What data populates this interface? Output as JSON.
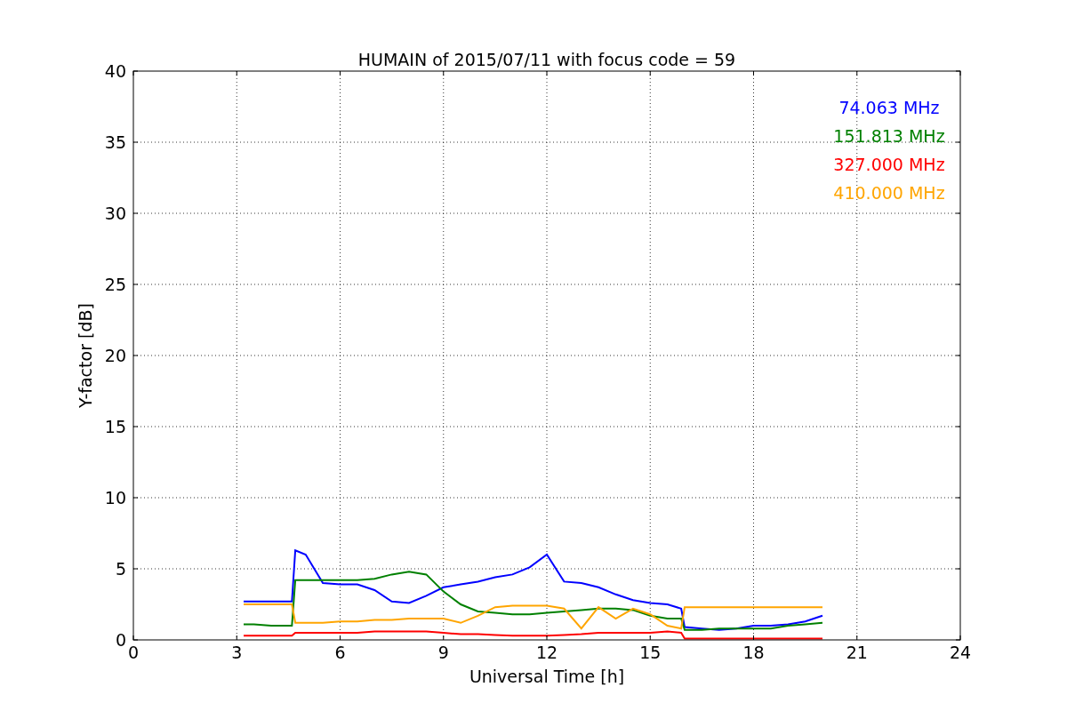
{
  "chart_data": {
    "type": "line",
    "title": "HUMAIN of 2015/07/11 with focus code = 59",
    "xlabel": "Universal Time [h]",
    "ylabel": "Y-factor [dB]",
    "xlim": [
      0,
      24
    ],
    "ylim": [
      0,
      40
    ],
    "xticks": [
      0,
      3,
      6,
      9,
      12,
      15,
      18,
      21,
      24
    ],
    "yticks": [
      0,
      5,
      10,
      15,
      20,
      25,
      30,
      35,
      40
    ],
    "grid": true,
    "x": [
      3.2,
      3.5,
      4,
      4.5,
      4.6,
      4.7,
      5,
      5.5,
      6,
      6.5,
      7,
      7.5,
      8,
      8.5,
      9,
      9.5,
      10,
      10.5,
      11,
      11.5,
      12,
      12.5,
      13,
      13.5,
      14,
      14.5,
      15,
      15.5,
      15.9,
      16,
      16.5,
      17,
      17.5,
      18,
      18.5,
      19,
      19.5,
      20
    ],
    "series": [
      {
        "name": "74.063 MHz",
        "color": "#0000ff",
        "values": [
          2.7,
          2.7,
          2.7,
          2.7,
          2.7,
          6.3,
          6,
          4,
          3.9,
          3.9,
          3.5,
          2.7,
          2.6,
          3.1,
          3.7,
          3.9,
          4.1,
          4.4,
          4.6,
          5.1,
          6.0,
          4.1,
          4.0,
          3.7,
          3.2,
          2.8,
          2.6,
          2.5,
          2.2,
          0.9,
          0.8,
          0.7,
          0.8,
          1.0,
          1.0,
          1.1,
          1.3,
          1.7
        ]
      },
      {
        "name": "151.813 MHz",
        "color": "#008000",
        "values": [
          1.1,
          1.1,
          1.0,
          1.0,
          1.0,
          4.2,
          4.2,
          4.2,
          4.2,
          4.2,
          4.3,
          4.6,
          4.8,
          4.6,
          3.4,
          2.5,
          2.0,
          1.9,
          1.8,
          1.8,
          1.9,
          2.0,
          2.1,
          2.2,
          2.2,
          2.1,
          1.7,
          1.5,
          1.5,
          0.7,
          0.7,
          0.8,
          0.8,
          0.8,
          0.8,
          1.0,
          1.1,
          1.2
        ]
      },
      {
        "name": "327.000 MHz",
        "color": "#ff0000",
        "values": [
          0.3,
          0.3,
          0.3,
          0.3,
          0.3,
          0.5,
          0.5,
          0.5,
          0.5,
          0.5,
          0.6,
          0.6,
          0.6,
          0.6,
          0.5,
          0.4,
          0.4,
          0.35,
          0.3,
          0.3,
          0.3,
          0.35,
          0.4,
          0.5,
          0.5,
          0.5,
          0.5,
          0.6,
          0.5,
          0.1,
          0.1,
          0.1,
          0.1,
          0.1,
          0.1,
          0.1,
          0.1,
          0.1
        ]
      },
      {
        "name": "410.000 MHz",
        "color": "#ffa500",
        "values": [
          2.5,
          2.5,
          2.5,
          2.5,
          2.5,
          1.2,
          1.2,
          1.2,
          1.3,
          1.3,
          1.4,
          1.4,
          1.5,
          1.5,
          1.5,
          1.2,
          1.7,
          2.3,
          2.4,
          2.4,
          2.4,
          2.2,
          0.8,
          2.3,
          1.5,
          2.2,
          1.8,
          1.0,
          0.8,
          2.3,
          2.3,
          2.3,
          2.3,
          2.3,
          2.3,
          2.3,
          2.3,
          2.3
        ]
      }
    ]
  }
}
